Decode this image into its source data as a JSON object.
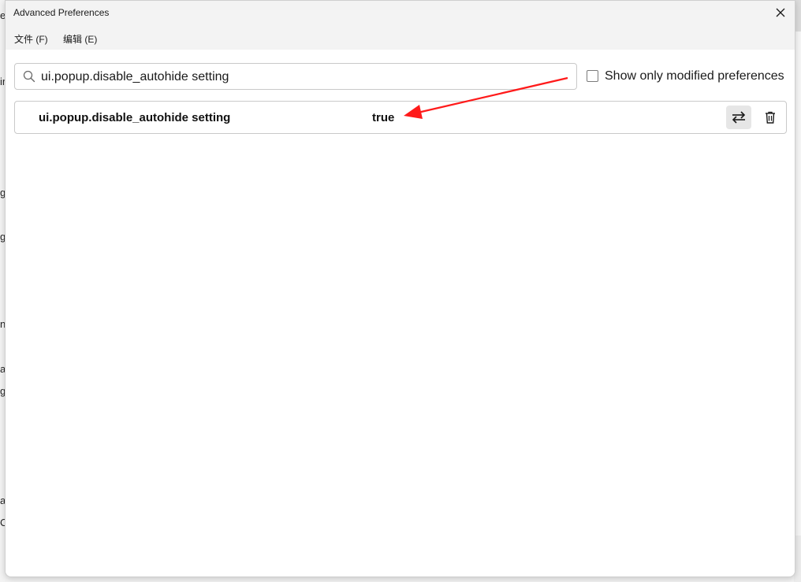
{
  "window": {
    "title": "Advanced Preferences"
  },
  "menu": {
    "file": "文件 (F)",
    "edit": "编辑 (E)"
  },
  "search": {
    "value": "ui.popup.disable_autohide setting",
    "icon": "search-icon"
  },
  "filter": {
    "label": "Show only modified preferences",
    "checked": false
  },
  "preferences": [
    {
      "name": "ui.popup.disable_autohide setting",
      "value": "true",
      "actions": [
        "toggle-icon",
        "trash-icon"
      ]
    }
  ],
  "background_fragments": [
    "er",
    "ir",
    "g",
    "g",
    "n",
    "a",
    "g",
    "a",
    "C"
  ],
  "colors": {
    "annotation_arrow": "#ff1a1a",
    "toggle_button_bg": "#e6e6e6"
  }
}
